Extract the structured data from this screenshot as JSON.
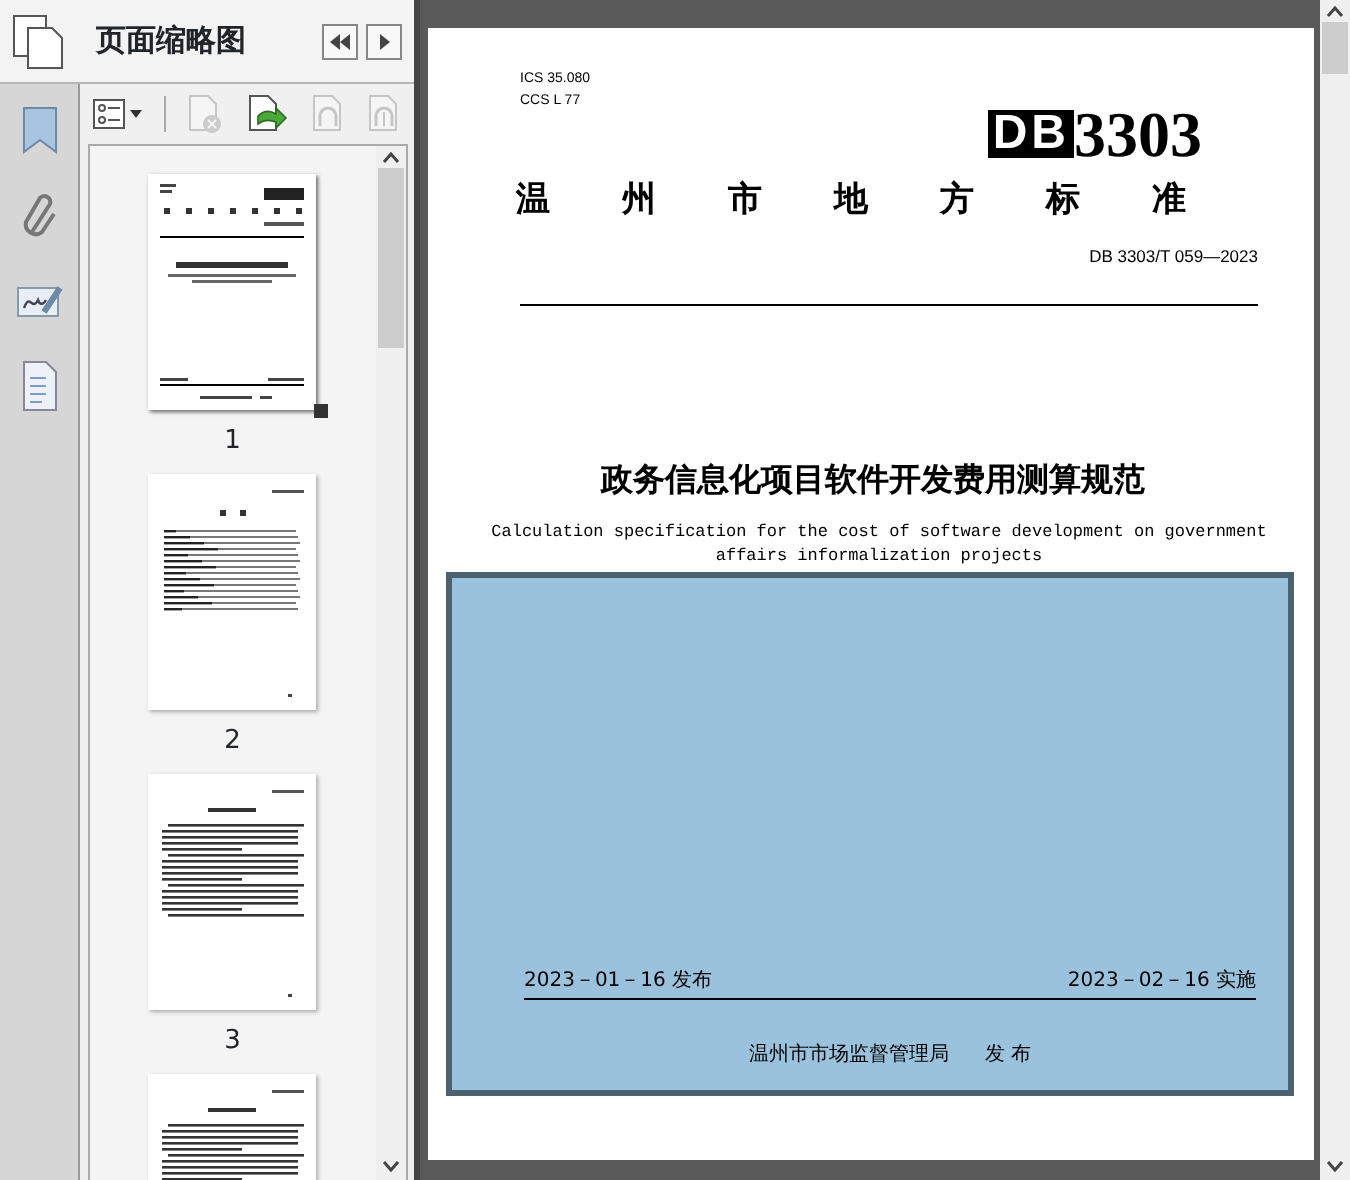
{
  "panel": {
    "title": "页面缩略图"
  },
  "toolbar": [
    {
      "kind": "options",
      "disabled": false
    },
    {
      "kind": "delete",
      "disabled": true
    },
    {
      "kind": "insert",
      "disabled": false
    },
    {
      "kind": "undo",
      "disabled": true
    },
    {
      "kind": "redo",
      "disabled": true
    }
  ],
  "thumbnails": [
    {
      "kind": "cover",
      "label": "1",
      "selected": true
    },
    {
      "kind": "contents",
      "label": "2",
      "selected": false
    },
    {
      "kind": "text",
      "label": "3",
      "selected": false
    },
    {
      "kind": "text",
      "selected": false
    }
  ],
  "document": {
    "ics": "ICS  35.080",
    "ccs": "CCS  L 77",
    "logo_letters": "DB",
    "logo_number": "3303",
    "heading": "温州市地方标准",
    "standard_no": "DB 3303/T  059—2023",
    "title": "政务信息化项目软件开发费用测算规范",
    "subtitle": "Calculation specification for the cost of software development on government affairs informalization projects",
    "issue_date": "2023－01－16 发布",
    "effective_date": "2023－02－16 实施",
    "publisher": "温州市市场监督管理局",
    "publisher_action": "发  布"
  }
}
